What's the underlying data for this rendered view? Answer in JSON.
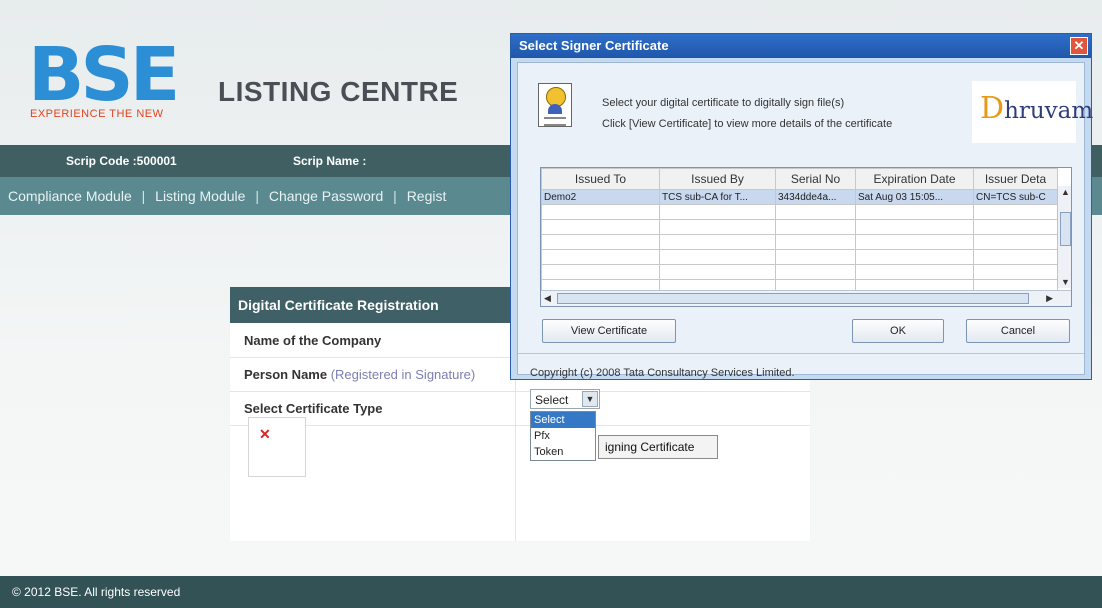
{
  "header": {
    "logo_text": "BSE",
    "logo_tagline": "EXPERIENCE THE NEW",
    "site_title": "LISTING CENTRE"
  },
  "scrip_bar": {
    "scrip_code": "Scrip Code :500001",
    "scrip_name": "Scrip Name :"
  },
  "nav": {
    "items": [
      "Compliance Module",
      "Listing Module",
      "Change Password",
      "Regist"
    ]
  },
  "form": {
    "title": "Digital Certificate Registration",
    "company_label": "Name of the Company",
    "person_label": "Person Name",
    "person_note": "(Registered in Signature)",
    "cert_type_label": "Select Certificate Type",
    "select_value": "Select",
    "dropdown_options": [
      "Select",
      "Pfx",
      "Token"
    ],
    "sign_button": "igning Certificate"
  },
  "dialog": {
    "title": "Select Signer Certificate",
    "message_1": "Select your digital certificate to digitally sign file(s)",
    "message_2": "Click [View Certificate] to view more details of the certificate",
    "brand": "hruvam",
    "brand_initial": "D",
    "columns": [
      "Issued To",
      "Issued By",
      "Serial No",
      "Expiration Date",
      "Issuer Deta"
    ],
    "rows": [
      [
        "Demo2",
        "TCS sub-CA for T...",
        "3434dde4a...",
        "Sat Aug 03 15:05...",
        "CN=TCS sub-C"
      ]
    ],
    "view_certificate": "View Certificate",
    "ok": "OK",
    "cancel": "Cancel",
    "copyright": "Copyright (c) 2008 Tata Consultancy Services Limited."
  },
  "footer": {
    "text": "© 2012 BSE. All rights reserved"
  },
  "colors": {
    "brand_blue": "#2c8fd6",
    "nav_bg": "#5a8a90",
    "header_bar": "#3f5f63",
    "dialog_title": "#2f6fc9",
    "selection": "#3478c6"
  }
}
